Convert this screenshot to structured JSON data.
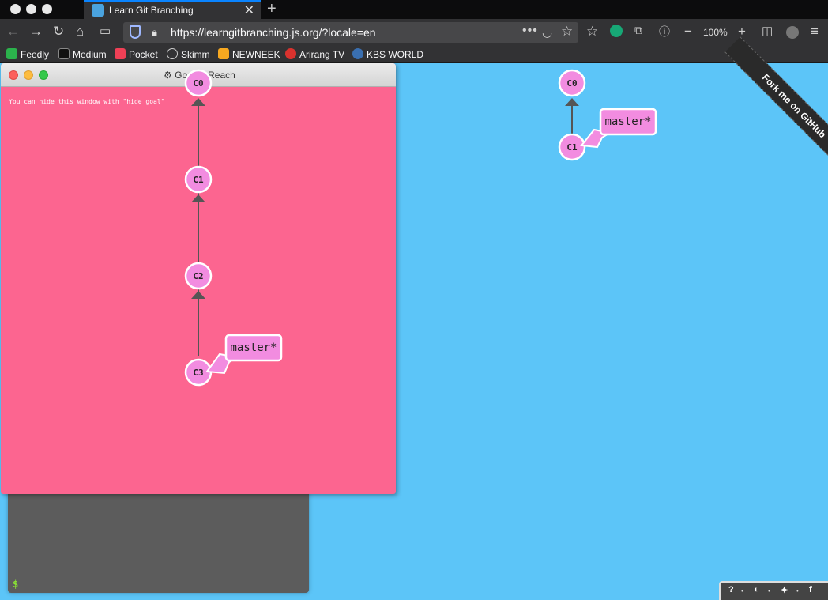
{
  "browser": {
    "tab_title": "Learn Git Branching",
    "url": "https://learngitbranching.js.org/?locale=en",
    "zoom": "100%",
    "bookmarks": [
      {
        "label": "Feedly",
        "color": "#2bb24c"
      },
      {
        "label": "Medium",
        "color": "#111111"
      },
      {
        "label": "Pocket",
        "color": "#ef4056"
      },
      {
        "label": "Skimm",
        "color": "#9a9a9a"
      },
      {
        "label": "NEWNEEK",
        "color": "#f7a820"
      },
      {
        "label": "Arirang TV",
        "color": "#d9322e"
      },
      {
        "label": "KBS WORLD",
        "color": "#3a6fb0"
      }
    ]
  },
  "goal_window": {
    "title": "Goal to Reach",
    "hint": "You can hide this window with \"hide goal\"",
    "commits": [
      "C0",
      "C1",
      "C2",
      "C3"
    ],
    "branch_label": "master*"
  },
  "main_tree": {
    "commits": [
      "C0",
      "C1"
    ],
    "branch_label": "master*"
  },
  "ribbon": "Fork me on GitHub",
  "terminal": {
    "prompt": "$"
  },
  "colors": {
    "background": "#5cc5f8",
    "goal_background": "#fc6590",
    "commit_fill": "#f28ce0",
    "terminal": "#5c5c5c"
  },
  "help_bar": [
    "?",
    "globe-icon",
    "twitter-icon",
    "f"
  ]
}
